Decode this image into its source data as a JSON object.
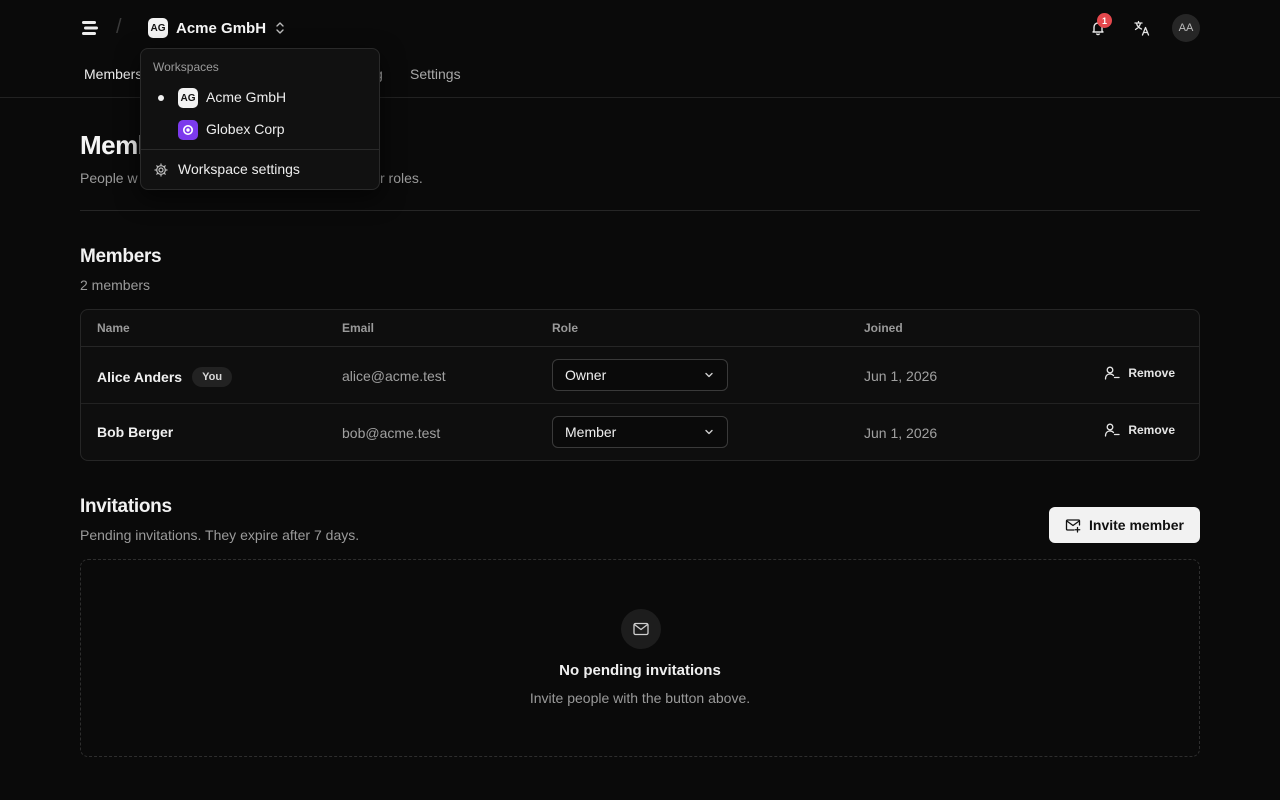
{
  "topbar": {
    "workspace_badge": "AG",
    "workspace_name": "Acme GmbH",
    "notification_count": "1",
    "avatar_initials": "AA"
  },
  "nav": {
    "tabs": [
      {
        "label": "Members"
      },
      {
        "label": "g"
      },
      {
        "label": "Settings"
      }
    ]
  },
  "page": {
    "title": "Memb",
    "subtitle_left": "People w",
    "subtitle_right": "r roles."
  },
  "members": {
    "title": "Members",
    "count_label": "2 members",
    "columns": [
      "Name",
      "Email",
      "Role",
      "Joined"
    ],
    "rows": [
      {
        "name": "Alice Anders",
        "badge": "You",
        "email": "alice@acme.test",
        "role": "Owner",
        "joined": "Jun 1, 2026",
        "action": "Remove"
      },
      {
        "name": "Bob Berger",
        "badge": "",
        "email": "bob@acme.test",
        "role": "Member",
        "joined": "Jun 1, 2026",
        "action": "Remove"
      }
    ]
  },
  "invitations": {
    "title": "Invitations",
    "subtitle": "Pending invitations. They expire after 7 days.",
    "invite_button": "Invite member",
    "empty_title": "No pending invitations",
    "empty_subtitle": "Invite people with the button above."
  },
  "dropdown": {
    "label": "Workspaces",
    "items": [
      {
        "badge": "AG",
        "name": "Acme GmbH",
        "selected": true
      },
      {
        "badge": "",
        "name": "Globex Corp",
        "selected": false
      }
    ],
    "settings_label": "Workspace settings"
  },
  "colors": {
    "background": "#0a0a0a",
    "notification": "#e5484d",
    "globex_badge": "#7c3aed"
  }
}
